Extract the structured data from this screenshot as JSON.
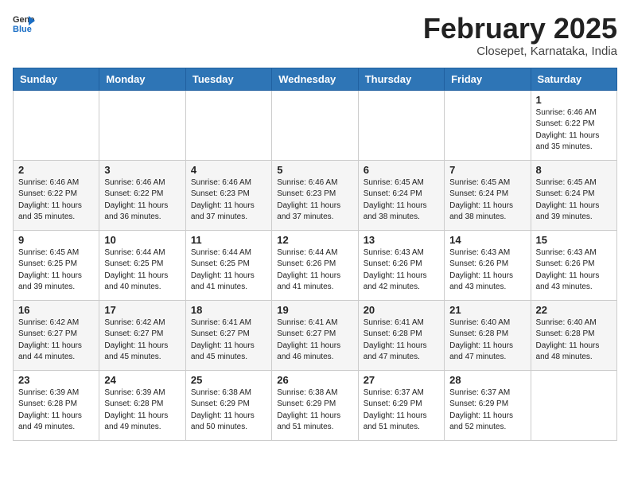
{
  "header": {
    "logo_general": "General",
    "logo_blue": "Blue",
    "month_title": "February 2025",
    "location": "Closepet, Karnataka, India"
  },
  "weekdays": [
    "Sunday",
    "Monday",
    "Tuesday",
    "Wednesday",
    "Thursday",
    "Friday",
    "Saturday"
  ],
  "weeks": [
    [
      {
        "day": "",
        "info": ""
      },
      {
        "day": "",
        "info": ""
      },
      {
        "day": "",
        "info": ""
      },
      {
        "day": "",
        "info": ""
      },
      {
        "day": "",
        "info": ""
      },
      {
        "day": "",
        "info": ""
      },
      {
        "day": "1",
        "info": "Sunrise: 6:46 AM\nSunset: 6:22 PM\nDaylight: 11 hours\nand 35 minutes."
      }
    ],
    [
      {
        "day": "2",
        "info": "Sunrise: 6:46 AM\nSunset: 6:22 PM\nDaylight: 11 hours\nand 35 minutes."
      },
      {
        "day": "3",
        "info": "Sunrise: 6:46 AM\nSunset: 6:22 PM\nDaylight: 11 hours\nand 36 minutes."
      },
      {
        "day": "4",
        "info": "Sunrise: 6:46 AM\nSunset: 6:23 PM\nDaylight: 11 hours\nand 37 minutes."
      },
      {
        "day": "5",
        "info": "Sunrise: 6:46 AM\nSunset: 6:23 PM\nDaylight: 11 hours\nand 37 minutes."
      },
      {
        "day": "6",
        "info": "Sunrise: 6:45 AM\nSunset: 6:24 PM\nDaylight: 11 hours\nand 38 minutes."
      },
      {
        "day": "7",
        "info": "Sunrise: 6:45 AM\nSunset: 6:24 PM\nDaylight: 11 hours\nand 38 minutes."
      },
      {
        "day": "8",
        "info": "Sunrise: 6:45 AM\nSunset: 6:24 PM\nDaylight: 11 hours\nand 39 minutes."
      }
    ],
    [
      {
        "day": "9",
        "info": "Sunrise: 6:45 AM\nSunset: 6:25 PM\nDaylight: 11 hours\nand 39 minutes."
      },
      {
        "day": "10",
        "info": "Sunrise: 6:44 AM\nSunset: 6:25 PM\nDaylight: 11 hours\nand 40 minutes."
      },
      {
        "day": "11",
        "info": "Sunrise: 6:44 AM\nSunset: 6:25 PM\nDaylight: 11 hours\nand 41 minutes."
      },
      {
        "day": "12",
        "info": "Sunrise: 6:44 AM\nSunset: 6:26 PM\nDaylight: 11 hours\nand 41 minutes."
      },
      {
        "day": "13",
        "info": "Sunrise: 6:43 AM\nSunset: 6:26 PM\nDaylight: 11 hours\nand 42 minutes."
      },
      {
        "day": "14",
        "info": "Sunrise: 6:43 AM\nSunset: 6:26 PM\nDaylight: 11 hours\nand 43 minutes."
      },
      {
        "day": "15",
        "info": "Sunrise: 6:43 AM\nSunset: 6:26 PM\nDaylight: 11 hours\nand 43 minutes."
      }
    ],
    [
      {
        "day": "16",
        "info": "Sunrise: 6:42 AM\nSunset: 6:27 PM\nDaylight: 11 hours\nand 44 minutes."
      },
      {
        "day": "17",
        "info": "Sunrise: 6:42 AM\nSunset: 6:27 PM\nDaylight: 11 hours\nand 45 minutes."
      },
      {
        "day": "18",
        "info": "Sunrise: 6:41 AM\nSunset: 6:27 PM\nDaylight: 11 hours\nand 45 minutes."
      },
      {
        "day": "19",
        "info": "Sunrise: 6:41 AM\nSunset: 6:27 PM\nDaylight: 11 hours\nand 46 minutes."
      },
      {
        "day": "20",
        "info": "Sunrise: 6:41 AM\nSunset: 6:28 PM\nDaylight: 11 hours\nand 47 minutes."
      },
      {
        "day": "21",
        "info": "Sunrise: 6:40 AM\nSunset: 6:28 PM\nDaylight: 11 hours\nand 47 minutes."
      },
      {
        "day": "22",
        "info": "Sunrise: 6:40 AM\nSunset: 6:28 PM\nDaylight: 11 hours\nand 48 minutes."
      }
    ],
    [
      {
        "day": "23",
        "info": "Sunrise: 6:39 AM\nSunset: 6:28 PM\nDaylight: 11 hours\nand 49 minutes."
      },
      {
        "day": "24",
        "info": "Sunrise: 6:39 AM\nSunset: 6:28 PM\nDaylight: 11 hours\nand 49 minutes."
      },
      {
        "day": "25",
        "info": "Sunrise: 6:38 AM\nSunset: 6:29 PM\nDaylight: 11 hours\nand 50 minutes."
      },
      {
        "day": "26",
        "info": "Sunrise: 6:38 AM\nSunset: 6:29 PM\nDaylight: 11 hours\nand 51 minutes."
      },
      {
        "day": "27",
        "info": "Sunrise: 6:37 AM\nSunset: 6:29 PM\nDaylight: 11 hours\nand 51 minutes."
      },
      {
        "day": "28",
        "info": "Sunrise: 6:37 AM\nSunset: 6:29 PM\nDaylight: 11 hours\nand 52 minutes."
      },
      {
        "day": "",
        "info": ""
      }
    ]
  ]
}
